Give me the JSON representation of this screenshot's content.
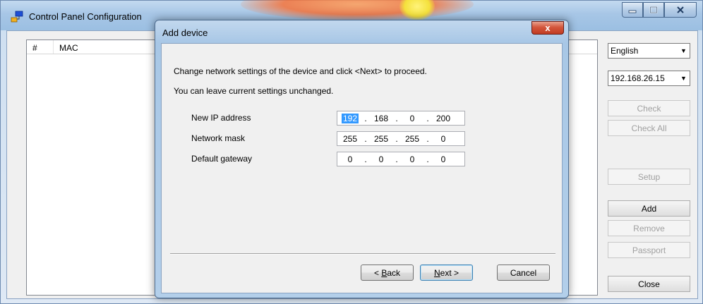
{
  "main_window": {
    "title": "Control Panel Configuration",
    "list_columns": [
      "#",
      "MAC"
    ],
    "language": "English",
    "ip_select": "192.168.26.15",
    "buttons": {
      "check": "Check",
      "check_all": "Check All",
      "setup": "Setup",
      "add": "Add",
      "remove": "Remove",
      "passport": "Passport",
      "close": "Close"
    }
  },
  "dialog": {
    "title": "Add device",
    "close_glyph": "x",
    "instruction1": "Change network settings of the device and click <Next> to proceed.",
    "instruction2": "You can leave current settings unchanged.",
    "fields": [
      {
        "label": "New IP address",
        "octets": [
          "192",
          "168",
          "0",
          "200"
        ]
      },
      {
        "label": "Network mask",
        "octets": [
          "255",
          "255",
          "255",
          "0"
        ]
      },
      {
        "label": "Default gateway",
        "octets": [
          "0",
          "0",
          "0",
          "0"
        ]
      }
    ],
    "buttons": {
      "back_prefix": "< ",
      "back_accel": "B",
      "back_rest": "ack",
      "next_accel": "N",
      "next_rest": "ext >",
      "cancel": "Cancel"
    }
  },
  "colors": {
    "selection": "#3399ff",
    "title_bar": "#a7c6e6",
    "close_red": "#c23c22"
  }
}
